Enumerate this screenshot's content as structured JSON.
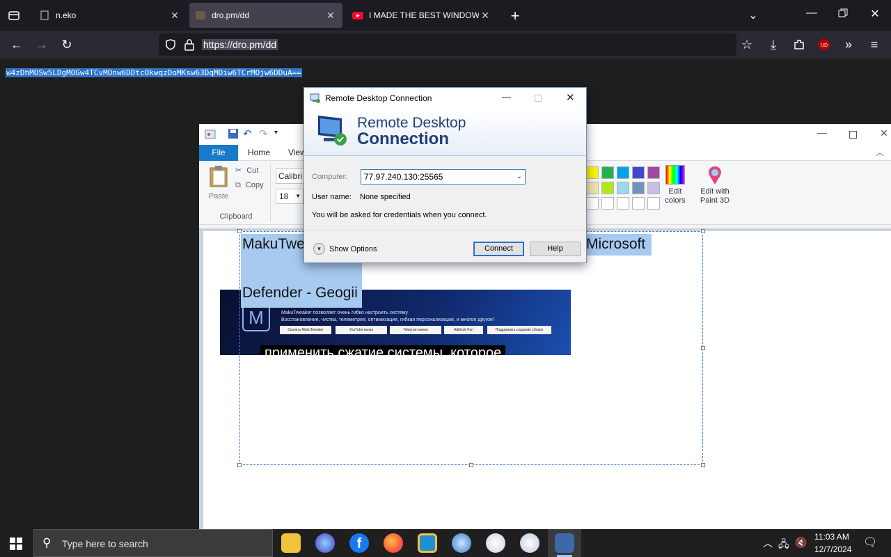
{
  "browser": {
    "tabs": [
      {
        "title": "n.eko",
        "active": false
      },
      {
        "title": "dro.pm/dd",
        "active": true
      },
      {
        "title": "I MADE THE BEST WINDOWS BUILD",
        "active": false
      }
    ],
    "url": "https://dro.pm/dd",
    "ublock_label": "UD"
  },
  "page": {
    "selected_text": "w4zDhMOSw5LDgMOGw4TCvMOnw6DDtcOkwqzDoMKsw63DqMOiw6TCrMOjw6DDuA=="
  },
  "paint": {
    "tabs": {
      "file": "File",
      "home": "Home",
      "view": "View"
    },
    "clipboard": {
      "paste": "Paste",
      "cut": "Cut",
      "copy": "Copy",
      "group": "Clipboard"
    },
    "font": {
      "name": "Calibri",
      "size": "18"
    },
    "edit_colors": "Edit colors",
    "edit_with_paint3d": "Edit with Paint 3D",
    "canvas_text_line1_left": "MakuTwe",
    "canvas_text_line1_right": "Microsoft",
    "canvas_text_line2": "Defender - Geogii",
    "embedded": {
      "intro": "MakuTweaker позволяет очень гибко настроить систему.",
      "features": "Восстановление, чистка, телеметрия, оптимизация, гибкая персонализация, и многое другое!",
      "buttons": [
        "Скачать MakuTweaker",
        "YouTube канал",
        "Telegram канал",
        "Adblock Fun",
        "Поддержать создание сборок"
      ],
      "caption": "применить сжатие системы, которое"
    }
  },
  "rdc": {
    "title": "Remote Desktop Connection",
    "banner_line1": "Remote Desktop",
    "banner_line2": "Connection",
    "computer_label": "Computer:",
    "computer_value": "77.97.240.130:25565",
    "username_label": "User name:",
    "username_value": "None specified",
    "credentials_note": "You will be asked for credentials when you connect.",
    "show_options": "Show Options",
    "connect": "Connect",
    "help": "Help"
  },
  "taskbar": {
    "search_placeholder": "Type here to search",
    "time": "11:03 AM",
    "date": "12/7/2024"
  }
}
